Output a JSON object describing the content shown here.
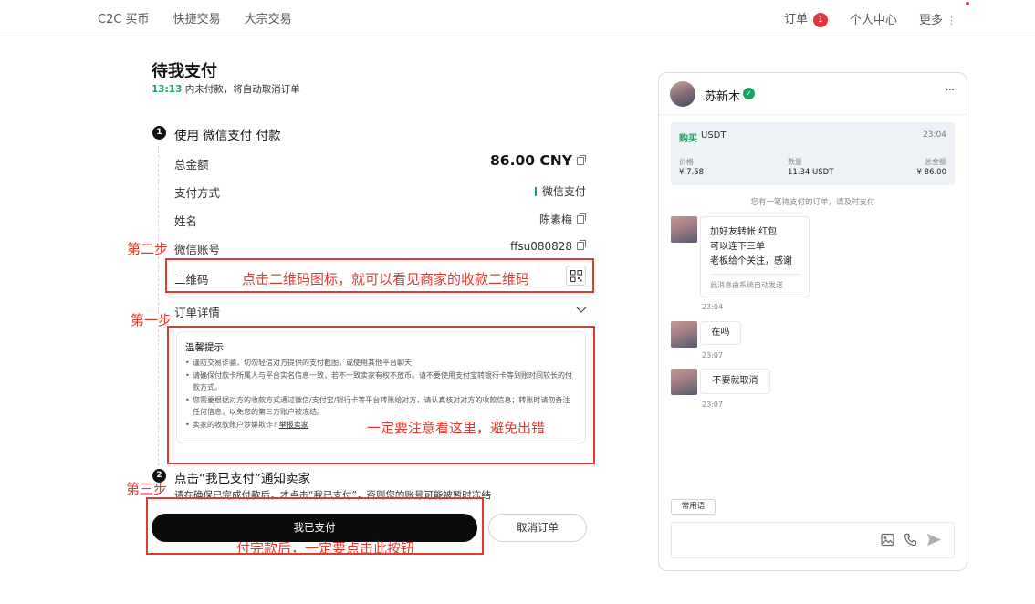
{
  "nav": {
    "left": [
      "C2C 买币",
      "快捷交易",
      "大宗交易"
    ],
    "orders": "订单",
    "orders_badge": "1",
    "profile": "个人中心",
    "more": "更多",
    "more_dots": "⋮"
  },
  "page": {
    "title": "待我支付",
    "countdown_time": "13:13",
    "countdown_text": "内未付款，将自动取消订单"
  },
  "step1": {
    "num": "1",
    "title": "使用 微信支付 付款",
    "rows": {
      "total_label": "总金额",
      "total_value": "86.00 CNY",
      "method_label": "支付方式",
      "method_value": "微信支付",
      "name_label": "姓名",
      "name_value": "陈素梅",
      "account_label": "微信账号",
      "account_value": "ffsu080828",
      "qr_label": "二维码",
      "details_label": "订单详情"
    }
  },
  "tips": {
    "title": "温馨提示",
    "items": [
      "谨防交易诈骗，切勿轻信对方提供的支付截图，或使用其他平台聊天",
      "请确保付款卡所属人与平台实名信息一致，若不一致卖家有权不放币。请不要使用支付宝转银行卡等到账时间较长的付款方式。",
      "您需要根据对方的收款方式通过微信/支付宝/银行卡等平台转账给对方，请认真核对对方的收款信息；转账时请勿备注任何信息，以免您的第三方账户被冻结。"
    ],
    "last_item": "卖家的收款账户涉嫌欺诈?",
    "report_link": "举报卖家"
  },
  "step2": {
    "num": "2",
    "title": "点击“我已支付”通知卖家",
    "desc": "请在确保已完成付款后，才点击“我已支付”，否则您的账号可能被暂时冻结",
    "paid_button": "我已支付",
    "cancel_button": "取消订单"
  },
  "annotations": {
    "step_one": "第一步",
    "step_two": "第二步",
    "step_three": "第三步",
    "qr_hint": "点击二维码图标，就可以看见商家的收款二维码",
    "tips_hint": "一定要注意看这里，避免出错",
    "button_hint": "付完款后，一定要点击此按钮"
  },
  "chat": {
    "merchant_name": "苏新木",
    "more": "···",
    "order": {
      "side": "购买",
      "coin": "USDT",
      "time": "23:04",
      "price_label": "价格",
      "price_value": "¥ 7.58",
      "qty_label": "数量",
      "qty_value": "11.34 USDT",
      "total_label": "总金额",
      "total_value": "¥ 86.00"
    },
    "system_note": "您有一笔待支付的订单，请及时支付",
    "messages": [
      {
        "lines": [
          "加好友转帐  红包",
          "可以连下三单",
          "老板给个关注，感谢"
        ],
        "auto": "此消息由系统自动发送",
        "time": "23:04"
      },
      {
        "text": "在吗",
        "time": "23:07"
      },
      {
        "text": "不要就取消",
        "time": "23:07"
      }
    ],
    "phrases_button": "常用语"
  },
  "colors": {
    "accent_green": "#1aa163",
    "annotation_red": "#e23b2e",
    "badge_red": "#e5333f",
    "primary_button": "#0b0b0b"
  }
}
